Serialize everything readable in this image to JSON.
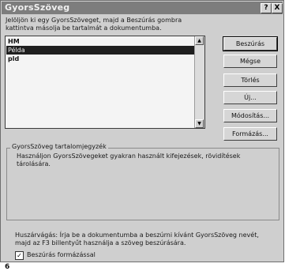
{
  "window": {
    "title": "GyorsSzöveg",
    "help_glyph": "?",
    "close_glyph": "X"
  },
  "instructions": {
    "line1": "Jelöljön ki egy GyorsSzöveget, majd a Beszúrás gombra",
    "line2": "kattintva másolja be tartalmát a dokumentumba."
  },
  "list": {
    "items": [
      "HM",
      "Példa",
      "pld"
    ],
    "selected_index": 1
  },
  "buttons": {
    "insert": "Beszúrás",
    "cancel": "Mégse",
    "delete": "Törlés",
    "new": "Új...",
    "modify": "Módosítás...",
    "format": "Formázás..."
  },
  "contents_group": {
    "title": "GyorsSzöveg tartalomjegyzék",
    "desc_line1": "Használjon GyorsSzövegeket gyakran használt kifejezések, rövidítések",
    "desc_line2": "tárolására."
  },
  "hint": {
    "line1": "Huszárvágás: Írja be a dokumentumba a beszúrni kívánt GyorsSzöveg nevét,",
    "line2": "majd az F3 billentyűt használja a szöveg beszúrására."
  },
  "insert_formatted": {
    "label": "Beszúrás formázással",
    "checked": true,
    "mark": "✓"
  },
  "page_number": "6"
}
